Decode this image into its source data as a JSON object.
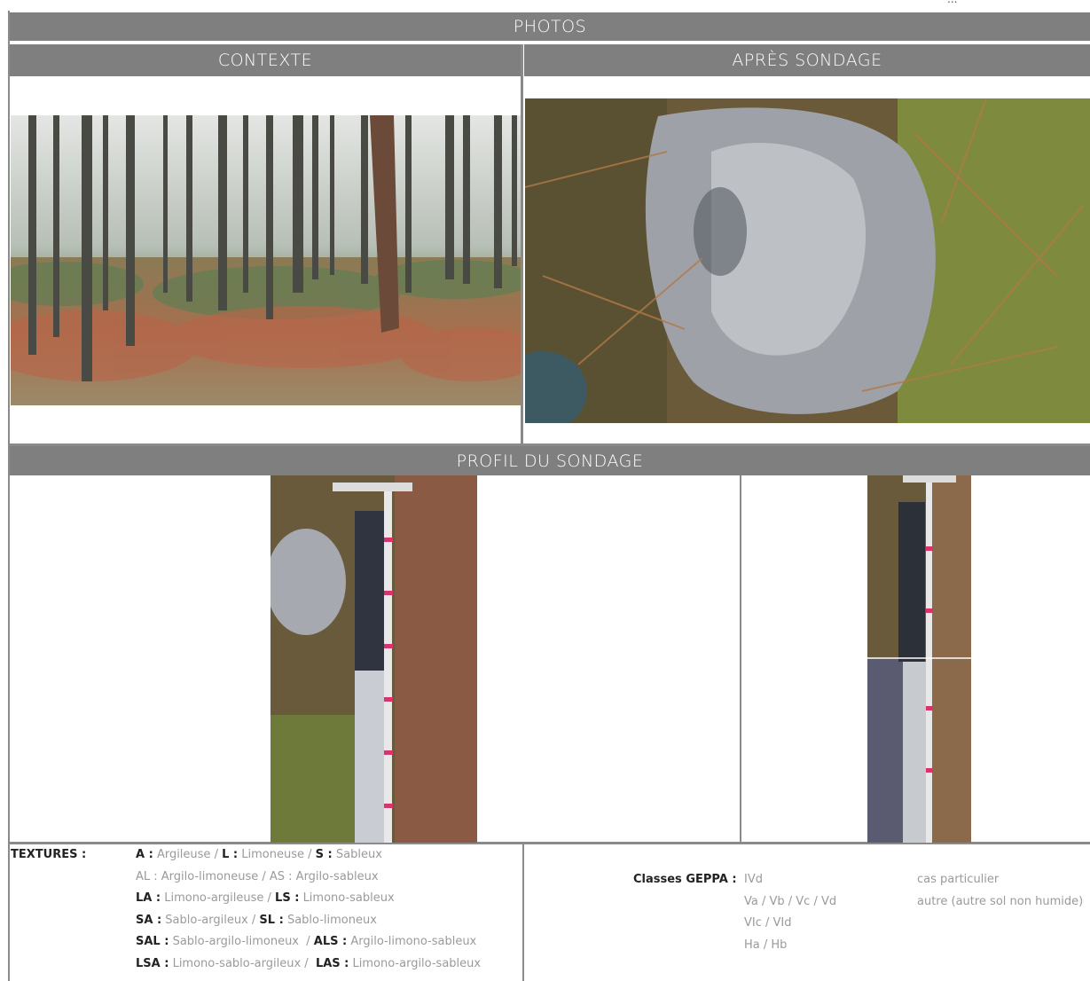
{
  "corner_text": "...",
  "sections": {
    "photos": "PHOTOS",
    "context": "CONTEXTE",
    "after": "APRÈS SONDAGE",
    "profile": "PROFIL DU SONDAGE"
  },
  "textures": {
    "title": "TEXTURES :",
    "lines": [
      [
        {
          "code": "A :",
          "name": "Argileuse"
        },
        {
          "sep": " / "
        },
        {
          "code": "L :",
          "name": "Limoneuse"
        },
        {
          "sep": " / "
        },
        {
          "code": "S :",
          "name": "Sableux"
        }
      ],
      [
        {
          "plain": "AL : Argilo-limoneuse / AS : Argilo-sableux"
        }
      ],
      [
        {
          "code": "LA :",
          "name": "Limono-argileuse"
        },
        {
          "sep": " / "
        },
        {
          "code": "LS :",
          "name": "Limono-sableux"
        }
      ],
      [
        {
          "code": "SA :",
          "name": "Sablo-argileux"
        },
        {
          "sep": " / "
        },
        {
          "code": "SL :",
          "name": "Sablo-limoneux"
        }
      ],
      [
        {
          "code": "SAL :",
          "name": "Sablo-argilo-limoneux"
        },
        {
          "sep": "  / "
        },
        {
          "code": "ALS :",
          "name": "Argilo-limono-sableux"
        }
      ],
      [
        {
          "code": "LSA :",
          "name": "Limono-sablo-argileux"
        },
        {
          "sep": " /  "
        },
        {
          "code": "LAS :",
          "name": "Limono-argilo-sableux"
        }
      ]
    ]
  },
  "geppa": {
    "label": "Classes GEPPA :",
    "classes": [
      "IVd",
      "Va / Vb / Vc / Vd",
      "VIc / VId",
      "Ha / Hb"
    ],
    "notes": [
      "cas particulier",
      "autre (autre sol non humide)"
    ]
  },
  "images": {
    "context": "forest-photo",
    "after": "soil-surface-photo",
    "profile_left": "auger-profile-photo",
    "profile_right": "auger-profile-photo-small"
  }
}
